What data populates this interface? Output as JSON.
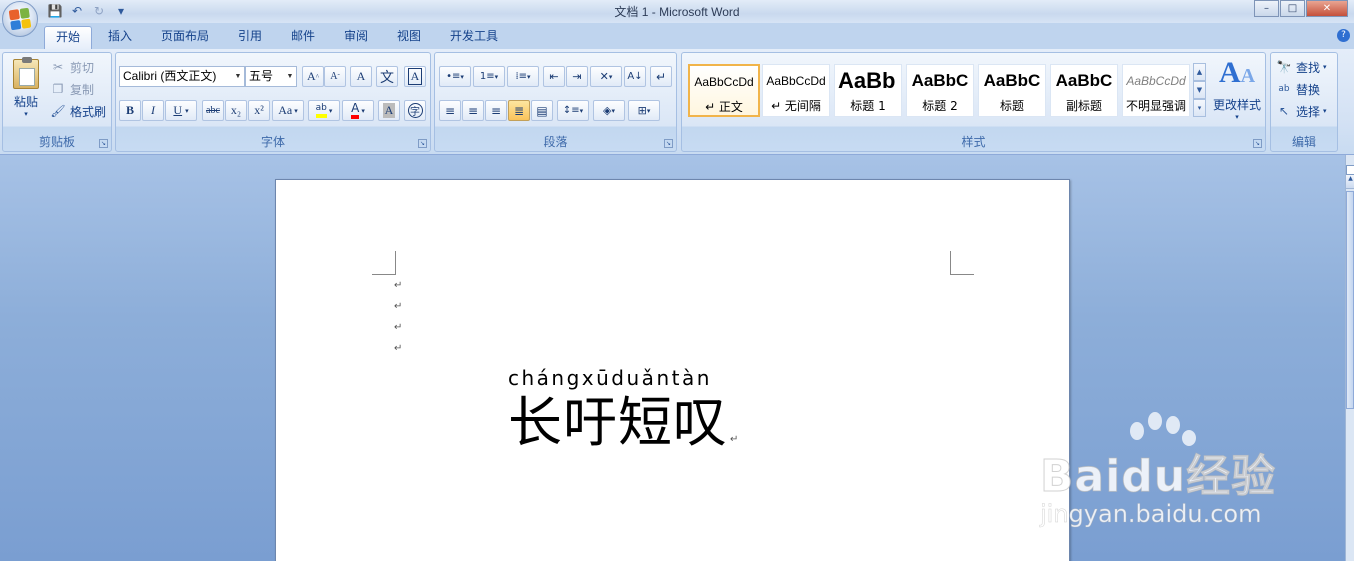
{
  "window": {
    "title": "文档 1 - Microsoft Word",
    "minimize_glyph": "–",
    "maximize_glyph": "□",
    "close_glyph": "✕",
    "help_glyph": "?"
  },
  "quick_access": {
    "save_glyph": "💾",
    "undo_glyph": "↶",
    "redo_glyph": "↻",
    "customize_glyph": "▾"
  },
  "tabs": [
    "开始",
    "插入",
    "页面布局",
    "引用",
    "邮件",
    "审阅",
    "视图",
    "开发工具"
  ],
  "clipboard": {
    "paste": "粘贴",
    "cut": "剪切",
    "copy": "复制",
    "format_painter": "格式刷",
    "label": "剪贴板"
  },
  "font": {
    "name": "Calibri (西文正文)",
    "size": "五号",
    "label": "字体",
    "buttons": {
      "grow": "A",
      "shrink": "A",
      "clear": "A",
      "phonetic": "文",
      "border": "A",
      "bold": "B",
      "italic": "I",
      "underline": "U",
      "strike": "abc",
      "subscript": "x₂",
      "superscript": "x²",
      "change_case": "Aa",
      "highlight": "ab",
      "color": "A",
      "shade": "A",
      "enclose": "字"
    }
  },
  "paragraph": {
    "label": "段落"
  },
  "styles": {
    "label": "样式",
    "items": [
      {
        "sample": "AaBbCcDd",
        "name": "↵ 正文"
      },
      {
        "sample": "AaBbCcDd",
        "name": "↵ 无间隔"
      },
      {
        "sample": "AaBb",
        "name": "标题 1"
      },
      {
        "sample": "AaBbC",
        "name": "标题 2"
      },
      {
        "sample": "AaBbC",
        "name": "标题"
      },
      {
        "sample": "AaBbC",
        "name": "副标题"
      },
      {
        "sample": "AaBbCcDd",
        "name": "不明显强调"
      }
    ],
    "change_styles": "更改样式"
  },
  "editing": {
    "find": "查找",
    "replace": "替换",
    "select": "选择",
    "label": "编辑"
  },
  "document": {
    "paragraph_mark": "↵",
    "pinyin": "chángxūduǎntàn",
    "text": "长吁短叹"
  },
  "watermark": {
    "brand": "Baidu经验",
    "site": "jingyan.baidu.com"
  },
  "colors": {
    "accent": "#15428b",
    "highlight_yellow": "#ffff00",
    "font_color_red": "#ff0000",
    "selected_style_border": "#f1b44a"
  }
}
